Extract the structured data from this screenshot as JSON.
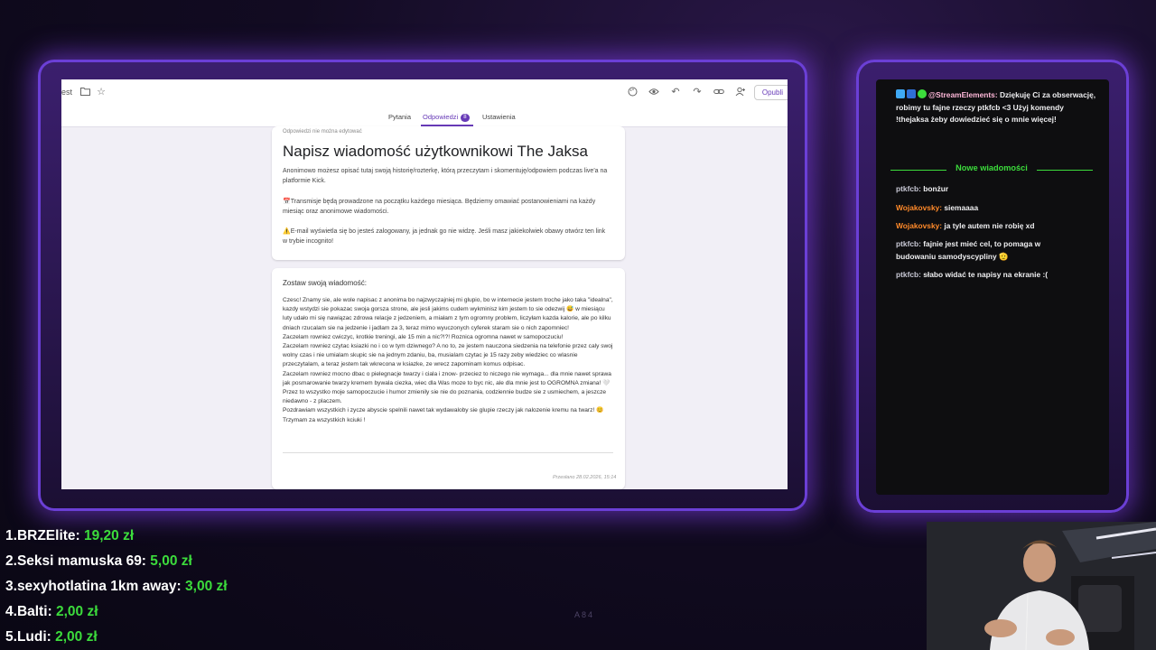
{
  "browser": {
    "tab_fragment": "est",
    "publish_label": "Opubli",
    "tabs": [
      {
        "label": "Pytania"
      },
      {
        "label": "Odpowiedzi",
        "badge": "8"
      },
      {
        "label": "Ustawienia"
      }
    ],
    "form": {
      "note": "Odpowiedzi nie można edytować",
      "title": "Napisz wiadomość użytkownikowi The Jaksa",
      "description_1": "Anonimowo możesz opisać tutaj swoją historię/rozterkę, którą przeczytam i skomentuję/odpowiem podczas live'a na platformie Kick.",
      "description_2": "📅Transmisje będą prowadzone na początku każdego miesiąca. Będziemy omawiać postanowieniami na każdy miesiąc oraz anonimowe wiadomości.",
      "description_3": "⚠️E-mail wyświetla się bo jesteś zalogowany, ja jednak go nie widzę. Jeśli masz jakiekolwiek obawy otwórz ten link w trybie incognito!",
      "question_label": "Zostaw swoją wiadomość:",
      "answer": "Czesc! Znamy sie, ale wole napisac z anonima bo najzwyczajniej mi glupio, bo w internecie jestem troche jako taka \"idealna\", kazdy wstydzi sie pokazac swoja gorsza strone, ale jesli jakims cudem wykminisz kim jestem to sie odezwij 😅 w miesiącu luty udało mi się nawiązac zdrowa relacje z jedzeniem, a miałam z tym ogromny problem, liczyłam kazda kalorie, ale po kilku dniach rzucalam sie na jedzenie i jadlam za 3, teraz mimo wyuczonych cyferek staram sie o nich zapomniec!\nZaczelam rowniez cwiczyc, krotkie treningi, ale 15 min a nic?!?! Roznica ogromna nawet w samopoczuciu!\nZaczelam rowniez czytac ksiazki no i co w tym dziwnego? A no to, ze jestem nauczona siedzenia na telefonie przez caly swoj wolny czas i nie umialam skupic sie na jednym zdaniu, ba, musialam czytac je 15 razy zeby wiedziec co wlasnie przeczytalam, a teraz jestem tak wkrecona w ksiazke, ze wrecz zapominam komus odpisac.\nZaczelam rowniez mocno dbac o pielegnacje twarzy i ciala i znow- przeciez to niczego nie wymaga... dla mnie nawet sprawa jak posmarowanie twarzy kremem bywala ciezka, wiec dla Was moze to byc nic, ale dla mnie jest to OGROMNA zmiana! 🤍\nPrzez to wszystko moje samopoczucie i humor zmienily sie nie do poznania, codziennie budze sie z usmiechem, a jeszcze niedawno - z placzem.\nPozdrawiam wszystkich i zycze abyscie spelnili nawet tak wydawaloby sie glupie rzeczy jak nalozenie kremu na twarz! 😊\nTrzymam za wszystkich kciuki !",
      "footer_note": "Przesłano 28.02.2026, 15:14"
    }
  },
  "chat": {
    "messages": [
      {
        "user": "@StreamElements",
        "color": "#ffb8d9",
        "text": "Dziękuję Ci za obserwację, robimy tu fajne rzeczy ptkfcb <3 Użyj komendy !thejaksa żeby dowiedzieć się o mnie więcej!"
      },
      {
        "user": "ptkfcb",
        "color": "#c9c9d6",
        "text": "bonżur"
      },
      {
        "user": "Wojakovsky",
        "color": "#ff8a2a",
        "text": "siemaaaa"
      },
      {
        "user": "Wojakovsky",
        "color": "#ff8a2a",
        "text": "ja tyle autem nie robię xd"
      },
      {
        "user": "ptkfcb",
        "color": "#c9c9d6",
        "text": "fajnie jest mieć cel, to pomaga w budowaniu samodyscypliny 🫡"
      },
      {
        "user": "ptkfcb",
        "color": "#c9c9d6",
        "text": "słabo widać te napisy na ekranie :("
      }
    ],
    "new_messages_label": "Nowe wiadomości"
  },
  "leaderboard": [
    {
      "rank": "1.",
      "name": "BRZElite:",
      "amount": "19,20 zł"
    },
    {
      "rank": "2.",
      "name": "Seksi mamuska 69:",
      "amount": "5,00 zł"
    },
    {
      "rank": "3.",
      "name": "sexyhotlatina 1km away:",
      "amount": "3,00 zł"
    },
    {
      "rank": "4.",
      "name": "Balti:",
      "amount": "2,00 zł"
    },
    {
      "rank": "5.",
      "name": "Ludi:",
      "amount": "2,00 zł"
    }
  ],
  "stream_code": "A84",
  "colors": {
    "accent": "#673ab7",
    "donation": "#3cdc3c",
    "frame_glow": "#8c46ff"
  }
}
